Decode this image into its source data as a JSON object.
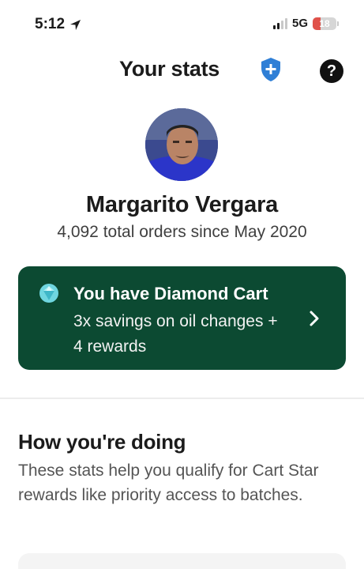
{
  "status_bar": {
    "time": "5:12",
    "network": "5G",
    "battery": "18"
  },
  "header": {
    "title": "Your stats"
  },
  "profile": {
    "name": "Margarito Vergara",
    "orders_text": "4,092 total orders since May 2020"
  },
  "diamond_card": {
    "title": "You have Diamond Cart",
    "description": "3x savings on oil changes + 4 rewards"
  },
  "section": {
    "title": "How you're doing",
    "description": "These stats help you qualify for Cart Star rewards like priority access to batches."
  },
  "icons": {
    "location": "location-arrow-icon",
    "shield": "shield-plus-icon",
    "help": "question-mark-icon",
    "gem": "diamond-gem-icon",
    "chevron": "chevron-right-icon"
  },
  "colors": {
    "card_background": "#0c4a32",
    "shield_blue": "#2f7fd6",
    "battery_red": "#e0524a"
  }
}
